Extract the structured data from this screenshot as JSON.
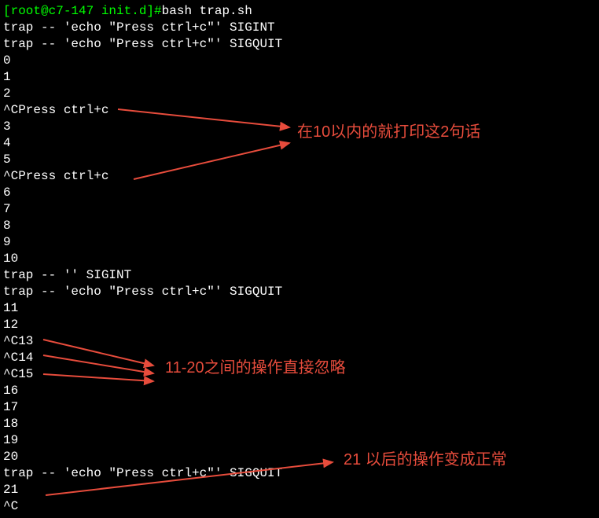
{
  "prompt": {
    "user_host": "[root@c7-147 init.d]#",
    "command": "bash trap.sh"
  },
  "lines": [
    "trap -- 'echo \"Press ctrl+c\"' SIGINT",
    "trap -- 'echo \"Press ctrl+c\"' SIGQUIT",
    "0",
    "1",
    "2",
    "^CPress ctrl+c",
    "3",
    "4",
    "5",
    "^CPress ctrl+c",
    "6",
    "7",
    "8",
    "9",
    "10",
    "trap -- '' SIGINT",
    "trap -- 'echo \"Press ctrl+c\"' SIGQUIT",
    "11",
    "12",
    "^C13",
    "^C14",
    "^C15",
    "16",
    "17",
    "18",
    "19",
    "20",
    "trap -- 'echo \"Press ctrl+c\"' SIGQUIT",
    "21",
    "^C"
  ],
  "annotations": {
    "note1": "在10以内的就打印这2句话",
    "note2": "11-20之间的操作直接忽略",
    "note3": "21 以后的操作变成正常"
  }
}
